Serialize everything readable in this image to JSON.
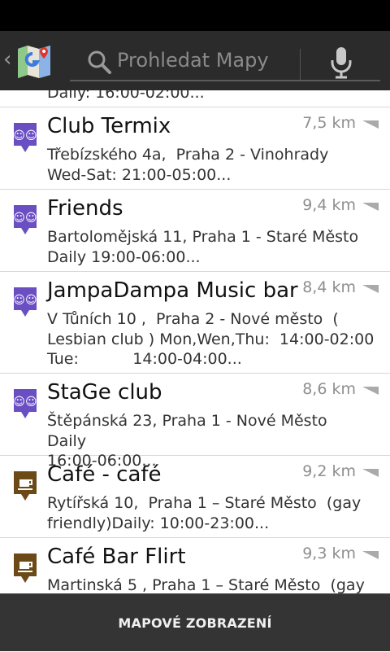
{
  "search": {
    "placeholder": "Prohledat Mapy"
  },
  "partial_item_text": "Daily: 16:00-02:00...",
  "places": [
    {
      "name": "Club Termix",
      "distance": "7,5 km",
      "description": "Třebízského 4a,  Praha 2 - Vinohrady\nWed-Sat: 21:00-05:00...",
      "icon": "club-icon"
    },
    {
      "name": "Friends",
      "distance": "9,4 km",
      "description": "Bartolomějská 11, Praha 1 - Staré Město\nDaily 19:00-06:00...",
      "icon": "club-icon"
    },
    {
      "name": "JampaDampa Music bar",
      "distance": "8,4 km",
      "description": "V Tůních 10 ,  Praha 2 - Nové město  (\nLesbian club ) Mon,Wen,Thu:  14:00-02:00\nTue:           14:00-04:00...",
      "icon": "club-icon"
    },
    {
      "name": "StaGe club",
      "distance": "8,6 km",
      "description": "Štěpánská 23, Praha 1 - Nové Město   Daily\n16:00-06:00...",
      "icon": "club-icon"
    },
    {
      "name": "Café - café",
      "distance": "9,2 km",
      "description": "Rytířská 10,  Praha 1 – Staré Město  (gay\nfriendly)Daily: 10:00-23:00...",
      "icon": "cafe-icon"
    },
    {
      "name": "Café Bar Flirt",
      "distance": "9,3 km",
      "description": "Martinská 5 , Praha 1 – Staré Město  (gay",
      "icon": "cafe-icon"
    }
  ],
  "bottom": {
    "map_view_label": "MAPOVÉ ZOBRAZENÍ"
  },
  "colors": {
    "club_pin": "#6a4fc3",
    "cafe_pin": "#6b4a17",
    "action_bar": "#2b2b2b",
    "bottom_bar": "#343434"
  }
}
